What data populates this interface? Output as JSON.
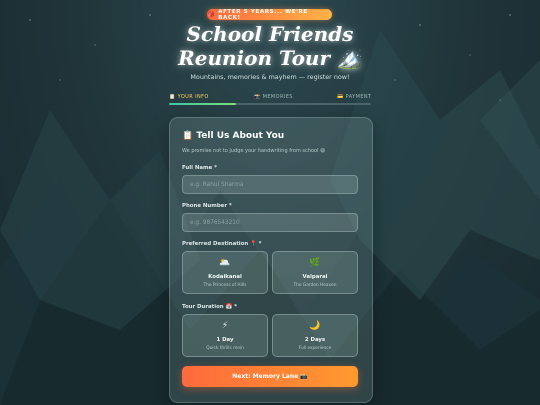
{
  "badge": {
    "icon": "🎒",
    "text": "AFTER 5 YEARS... WE'RE BACK!"
  },
  "hero": {
    "title_line1": "School Friends",
    "title_line2": "Reunion Tour 🏔️",
    "subtitle": "Mountains, memories & mayhem — register now!"
  },
  "steps": [
    {
      "icon": "📋",
      "label": "YOUR INFO",
      "active": true
    },
    {
      "icon": "📸",
      "label": "MEMORIES",
      "active": false
    },
    {
      "icon": "💳",
      "label": "PAYMENT",
      "active": false
    }
  ],
  "progress_fraction": 0.33,
  "form": {
    "title": "📋 Tell Us About You",
    "subtitle": "We promise not to judge your handwriting from school 😄",
    "full_name": {
      "label": "Full Name *",
      "placeholder": "e.g. Rahul Sharma",
      "value": ""
    },
    "phone": {
      "label": "Phone Number *",
      "placeholder": "e.g. 9876543210",
      "value": ""
    },
    "destination": {
      "label": "Preferred Destination 📍 *",
      "options": [
        {
          "icon": "🌥️",
          "name": "Kodaikanal",
          "desc": "The Princess of Hills"
        },
        {
          "icon": "🌿",
          "name": "Valparai",
          "desc": "The Garden Heaven"
        }
      ]
    },
    "duration": {
      "label": "Tour Duration 📅 *",
      "options": [
        {
          "icon": "⚡",
          "name": "1 Day",
          "desc": "Quick thrills mein"
        },
        {
          "icon": "🌙",
          "name": "2 Days",
          "desc": "Full experience"
        }
      ]
    },
    "next_button": "Next: Memory Lane 📸"
  },
  "colors": {
    "accent_orange": "#ff6a3d",
    "accent_yellow": "#ffcf60",
    "progress_green": "#3ec6a8"
  }
}
